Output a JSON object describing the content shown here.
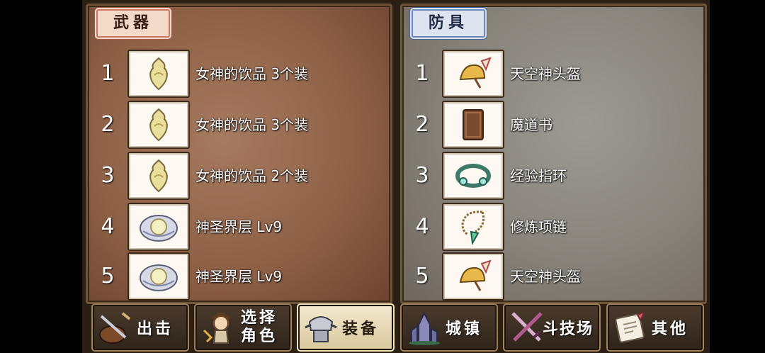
{
  "weapons": {
    "tab": "武器",
    "items": [
      {
        "num": "1",
        "name": "女神的饮品 3个装",
        "icon": "potion-icon"
      },
      {
        "num": "2",
        "name": "女神的饮品 3个装",
        "icon": "potion-icon"
      },
      {
        "num": "3",
        "name": "女神的饮品 2个装",
        "icon": "potion-icon"
      },
      {
        "num": "4",
        "name": "神圣界层 Lv9",
        "icon": "crystal-icon"
      },
      {
        "num": "5",
        "name": "神圣界层 Lv9",
        "icon": "crystal-icon"
      }
    ]
  },
  "armor": {
    "tab": "防具",
    "items": [
      {
        "num": "1",
        "name": "天空神头盔",
        "icon": "helmet-icon"
      },
      {
        "num": "2",
        "name": "魔道书",
        "icon": "book-icon"
      },
      {
        "num": "3",
        "name": "经验指环",
        "icon": "ring-icon"
      },
      {
        "num": "4",
        "name": "修炼项链",
        "icon": "necklace-icon"
      },
      {
        "num": "5",
        "name": "天空神头盔",
        "icon": "helmet-icon"
      }
    ]
  },
  "nav": {
    "attack": "出击",
    "select_line1": "选择",
    "select_line2": "角色",
    "equip": "装备",
    "town": "城镇",
    "arena": "斗技场",
    "other": "其他"
  }
}
